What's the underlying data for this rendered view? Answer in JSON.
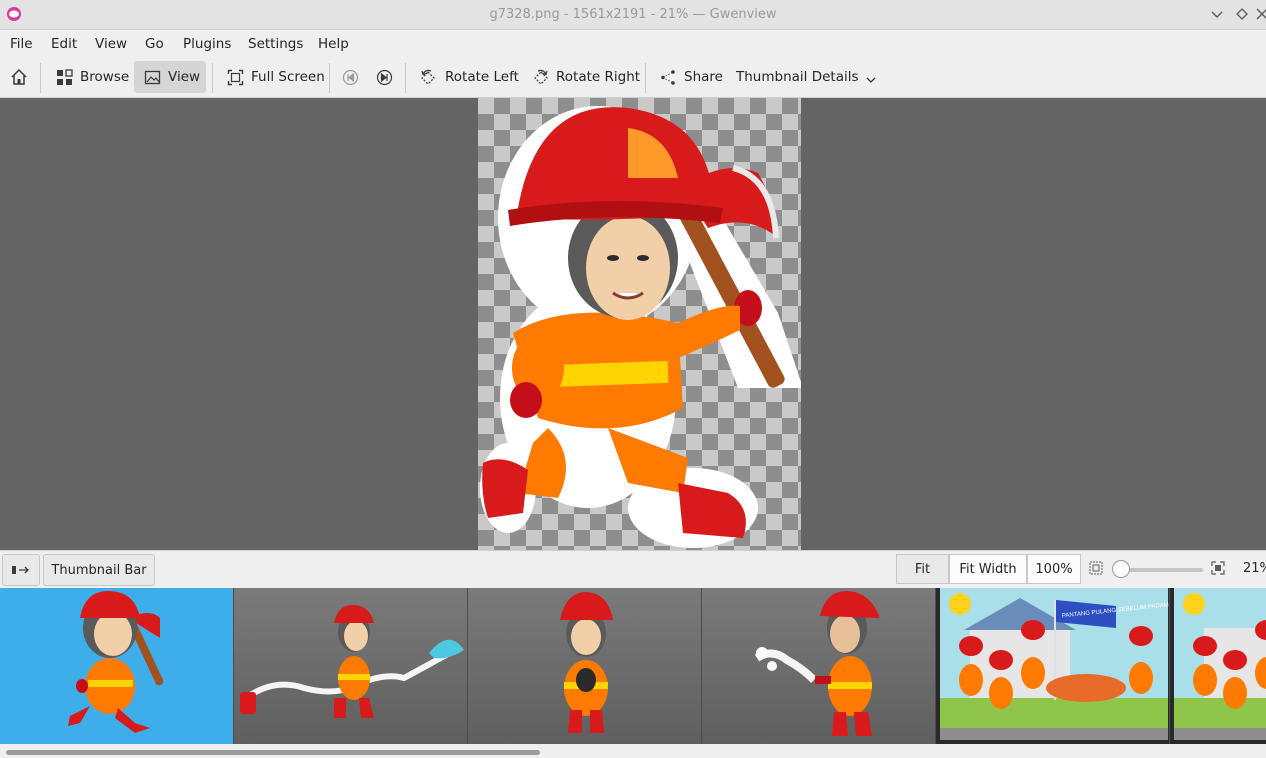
{
  "window": {
    "title": "g7328.png - 1561x2191 - 21% — Gwenview"
  },
  "menu": [
    "File",
    "Edit",
    "View",
    "Go",
    "Plugins",
    "Settings",
    "Help"
  ],
  "toolbar": {
    "home": "home-icon",
    "browse": "Browse",
    "view": "View",
    "full_screen": "Full Screen",
    "rotate_left": "Rotate Left",
    "rotate_right": "Rotate Right",
    "share": "Share",
    "thumbnail_details": "Thumbnail Details"
  },
  "statusbar": {
    "thumbnail_bar": "Thumbnail Bar",
    "fit": "Fit",
    "fit_width": "Fit Width",
    "hundred": "100%",
    "zoom": "21%"
  },
  "zoom_slider_level": 0.0,
  "thumbnails": [
    {
      "name": "firefighter-running-with-axe",
      "selected": true
    },
    {
      "name": "firefighter-with-hose-and-hydrant",
      "selected": false
    },
    {
      "name": "firefighter-holding-cat",
      "selected": false
    },
    {
      "name": "firefighter-spraying-water",
      "selected": false
    },
    {
      "name": "firefighter-team-scene",
      "selected": false
    },
    {
      "name": "firefighter-team-scene-partial",
      "selected": false
    }
  ],
  "scene_banner": "PANTANG PULANG SEBELUM PADAM",
  "colors": {
    "selection": "#3daee9",
    "viewer_bg": "#646464",
    "accent_red": "#d81a1a",
    "suit_orange": "#ff7a00"
  }
}
